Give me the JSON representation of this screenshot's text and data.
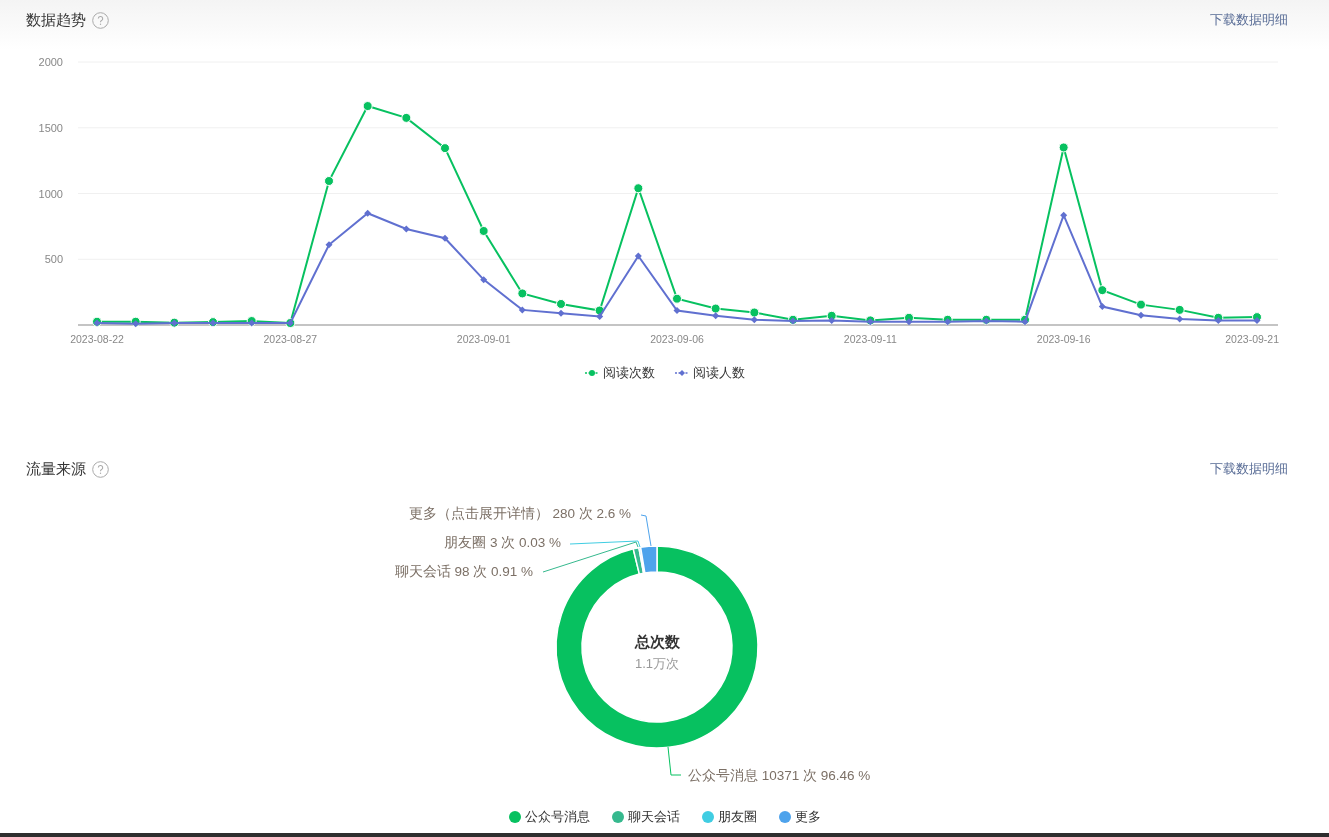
{
  "trend": {
    "title": "数据趋势",
    "download_link": "下载数据明细",
    "chart_data": {
      "type": "line",
      "grid": true,
      "categories": [
        "2023-08-22",
        null,
        null,
        null,
        null,
        "2023-08-27",
        null,
        null,
        null,
        null,
        "2023-09-01",
        null,
        null,
        null,
        null,
        "2023-09-06",
        null,
        null,
        null,
        null,
        "2023-09-11",
        null,
        null,
        null,
        null,
        "2023-09-16",
        null,
        null,
        null,
        null,
        "2023-09-21"
      ],
      "series": [
        {
          "name": "阅读次数",
          "color": "#07c160",
          "marker": "circle",
          "values": [
            25,
            25,
            18,
            22,
            30,
            15,
            1095,
            1665,
            1575,
            1345,
            715,
            240,
            160,
            110,
            1040,
            200,
            125,
            95,
            40,
            70,
            35,
            55,
            40,
            40,
            40,
            1350,
            265,
            155,
            115,
            55,
            60
          ]
        },
        {
          "name": "阅读人数",
          "color": "#6070d0",
          "marker": "diamond",
          "values": [
            15,
            10,
            15,
            15,
            15,
            15,
            610,
            850,
            730,
            660,
            345,
            115,
            90,
            65,
            525,
            110,
            70,
            40,
            30,
            35,
            25,
            25,
            25,
            30,
            25,
            835,
            140,
            75,
            45,
            35,
            35
          ]
        }
      ],
      "ylim": [
        0,
        2000
      ],
      "yticks": [
        500,
        1000,
        1500,
        2000
      ]
    }
  },
  "source": {
    "title": "流量来源",
    "download_link": "下载数据明细",
    "center_title": "总次数",
    "center_value": "1.1万次",
    "slice_labels": [
      "更多（点击展开详情） 280 次 2.6 %",
      "朋友圈 3 次 0.03 %",
      "聊天会话 98 次 0.91 %",
      "公众号消息 10371 次 96.46 %"
    ],
    "legend": [
      {
        "color": "#07c160"
      },
      {
        "color": "#36b98e"
      },
      {
        "color": "#40cde2"
      },
      {
        "color": "#4ea3ec"
      }
    ],
    "chart_data": {
      "type": "donut",
      "categories": [
        "公众号消息",
        "聊天会话",
        "朋友圈",
        "更多"
      ],
      "values": [
        96.46,
        0.91,
        0.03,
        2.6
      ]
    }
  }
}
